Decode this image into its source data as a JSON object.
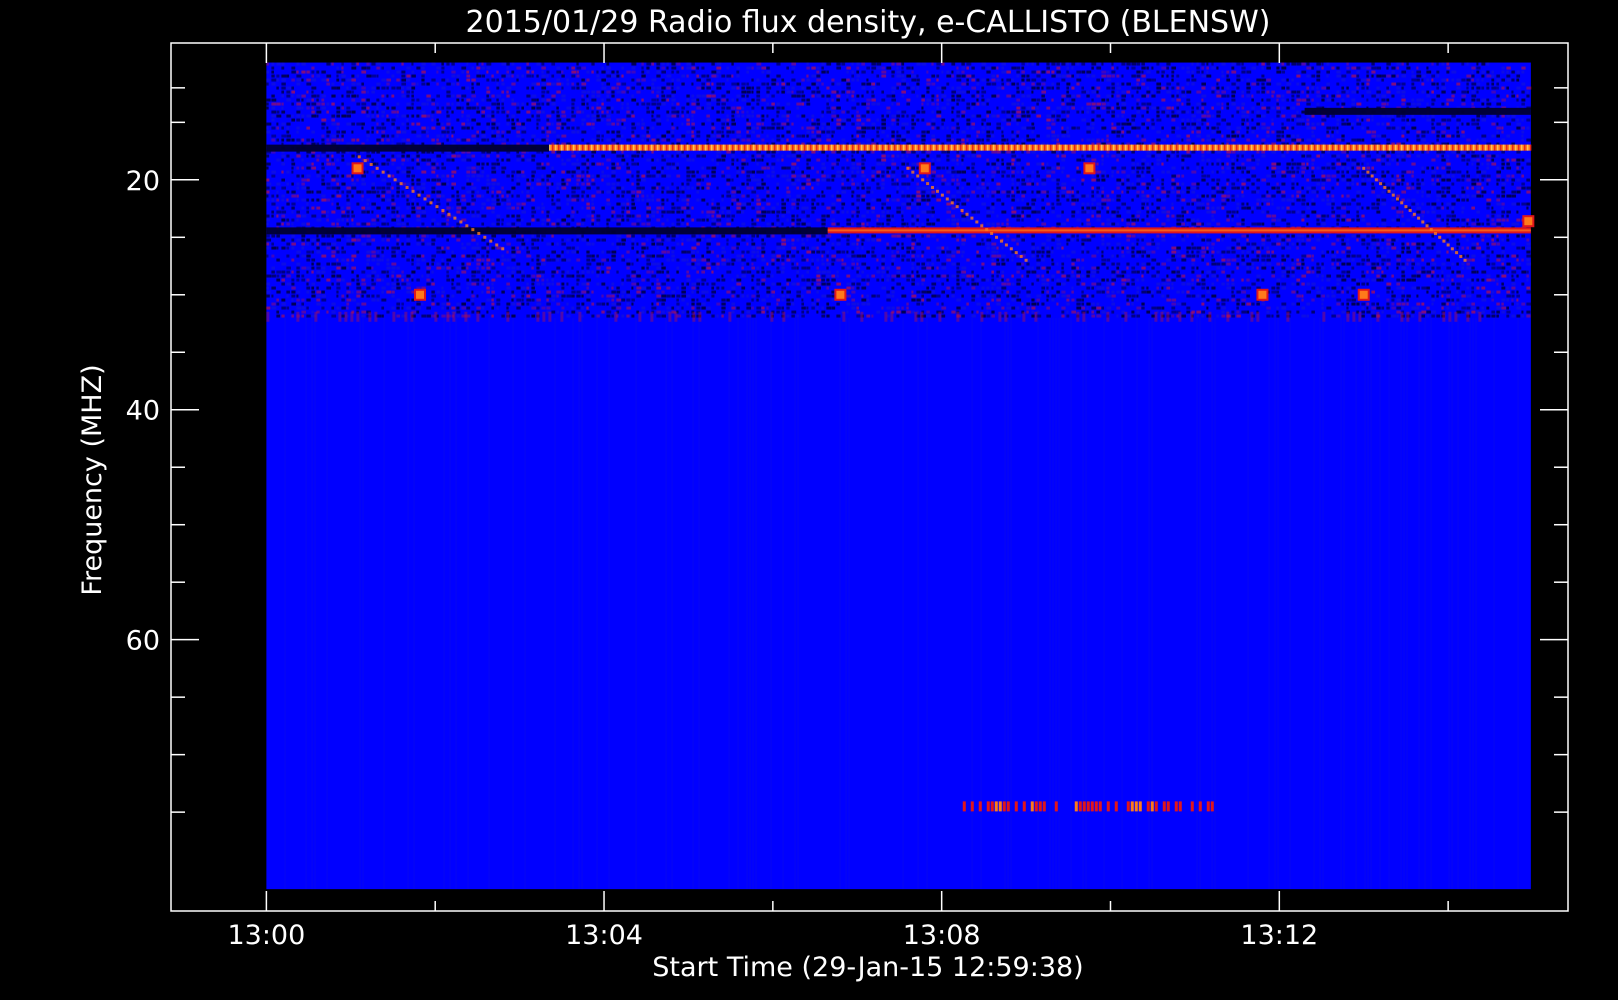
{
  "chart_data": {
    "type": "heatmap",
    "title": "2015/01/29  Radio flux density, e-CALLISTO (BLENSW)",
    "xlabel": "Start Time (29-Jan-15 12:59:38)",
    "ylabel": "Frequency (MHZ)",
    "x_axis": {
      "range_minutes": [
        -1.13,
        15.42
      ],
      "data_start_minutes": 0.0,
      "data_end_minutes": 14.98,
      "major_ticks": [
        {
          "minutes": 0,
          "label": "13:00"
        },
        {
          "minutes": 4,
          "label": "13:04"
        },
        {
          "minutes": 8,
          "label": "13:08"
        },
        {
          "minutes": 12,
          "label": "13:12"
        }
      ],
      "minor_ticks_minutes": [
        2,
        6,
        10,
        14
      ]
    },
    "y_axis": {
      "range": [
        8.1,
        83.6
      ],
      "inverted": true,
      "data_top_mhz": 9.8,
      "data_bottom_mhz": 81.7,
      "major_ticks": [
        {
          "value": 20,
          "label": "20"
        },
        {
          "value": 40,
          "label": "40"
        },
        {
          "value": 60,
          "label": "60"
        }
      ],
      "minor_ticks": [
        12,
        15,
        25,
        30,
        35,
        45,
        50,
        55,
        65,
        70,
        75
      ]
    },
    "background_level": "blue",
    "colors": {
      "background": "#000000",
      "frame": "#ffffff",
      "low": "#0000ff",
      "mid": "#1a1acc",
      "dark": "#000030",
      "red": "#e0161b",
      "orange": "#ff7a1a",
      "yellow": "#ffd060"
    },
    "features": [
      {
        "kind": "noise_band",
        "f_from": 9.8,
        "f_to": 32.0,
        "description_level": "mixed"
      },
      {
        "kind": "dark_line",
        "f": 17.2,
        "t_from": 0.0,
        "t_to": 3.35
      },
      {
        "kind": "striped_line",
        "f": 17.2,
        "t_from": 3.35,
        "t_to": 14.98
      },
      {
        "kind": "dark_line",
        "f": 14.0,
        "t_from": 12.3,
        "t_to": 14.98
      },
      {
        "kind": "dark_line",
        "f": 24.4,
        "t_from": 0.0,
        "t_to": 6.65
      },
      {
        "kind": "red_line",
        "f": 24.4,
        "t_from": 6.65,
        "t_to": 14.98
      },
      {
        "kind": "red_burst_row",
        "f": 74.5,
        "t_from": 8.25,
        "t_to": 11.2
      },
      {
        "kind": "hot_spot",
        "t": 1.08,
        "f": 19.0
      },
      {
        "kind": "hot_spot",
        "t": 1.82,
        "f": 30.0
      },
      {
        "kind": "hot_spot",
        "t": 6.8,
        "f": 30.0
      },
      {
        "kind": "hot_spot",
        "t": 7.8,
        "f": 19.0
      },
      {
        "kind": "hot_spot",
        "t": 9.75,
        "f": 19.0
      },
      {
        "kind": "hot_spot",
        "t": 11.8,
        "f": 30.0
      },
      {
        "kind": "hot_spot",
        "t": 13.0,
        "f": 30.0
      },
      {
        "kind": "hot_spot",
        "t": 14.95,
        "f": 23.6
      }
    ]
  }
}
